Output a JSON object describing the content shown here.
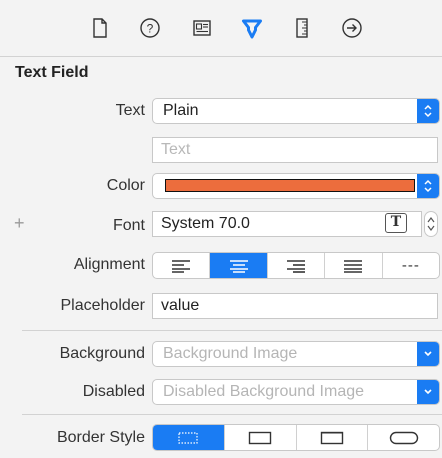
{
  "toolbar": {
    "icons": [
      "file-icon",
      "help-icon",
      "identity-icon",
      "attributes-icon",
      "size-icon",
      "connections-icon"
    ],
    "selected": "attributes-icon"
  },
  "section_title": "Text Field",
  "text": {
    "label": "Text",
    "value": "Plain"
  },
  "text_field": {
    "placeholder": "Text"
  },
  "color": {
    "label": "Color",
    "swatch": "#ec6d3d"
  },
  "font": {
    "label": "Font",
    "value": "System 70.0"
  },
  "alignment": {
    "label": "Alignment",
    "options": [
      "left",
      "center",
      "right",
      "justified",
      "natural"
    ],
    "selected": "center",
    "natural_glyph": "---"
  },
  "placeholder": {
    "label": "Placeholder",
    "value": "value"
  },
  "background": {
    "label": "Background",
    "placeholder": "Background Image"
  },
  "disabled": {
    "label": "Disabled",
    "placeholder": "Disabled Background Image"
  },
  "border_style": {
    "label": "Border Style",
    "options": [
      "none",
      "line",
      "bezel",
      "rounded"
    ],
    "selected": "none"
  },
  "colors": {
    "accent": "#1a7cf3",
    "border": "#c8c8c8",
    "background": "#f3f3f3"
  }
}
